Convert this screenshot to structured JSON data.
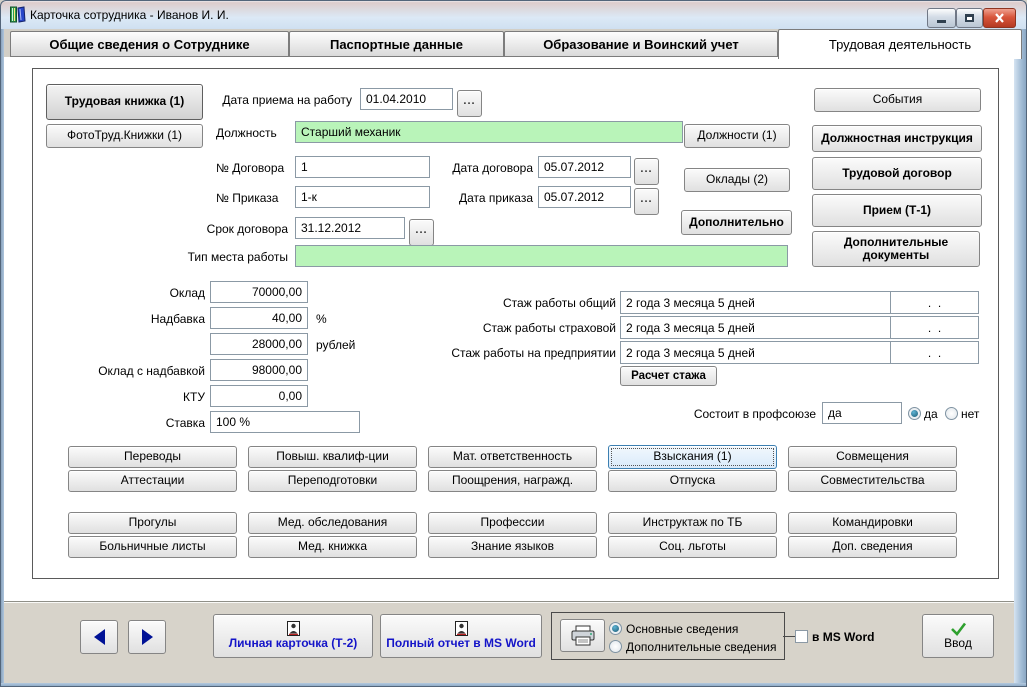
{
  "window": {
    "title": "Карточка сотрудника -  Иванов И. И."
  },
  "tabs": [
    {
      "label": "Общие сведения о Сотруднике"
    },
    {
      "label": "Паспортные данные"
    },
    {
      "label": "Образование и Воинский учет"
    },
    {
      "label": "Трудовая деятельность"
    }
  ],
  "colors": {
    "field_green": "#b9f4b9",
    "focus_blue": "#3c7fb1",
    "check_green": "#2ea02e",
    "link_blue": "#1414c8",
    "close_red": "#b53a22"
  },
  "left_panel": {
    "work_book": "Трудовая книжка (1)",
    "photo_book": "ФотоТруд.Книжки (1)"
  },
  "form": {
    "hire_date": {
      "label": "Дата приема на работу",
      "value": "01.04.2010"
    },
    "position": {
      "label": "Должность",
      "value": "Старший механик"
    },
    "contract_no": {
      "label": "№ Договора",
      "value": "1"
    },
    "contract_date": {
      "label": "Дата договора",
      "value": "05.07.2012"
    },
    "order_no": {
      "label": "№ Приказа",
      "value": "1-к"
    },
    "order_date": {
      "label": "Дата приказа",
      "value": "05.07.2012"
    },
    "contract_term": {
      "label": "Срок договора",
      "value": "31.12.2012"
    },
    "workplace_type": {
      "label": "Тип места работы",
      "value": ""
    },
    "ellipsis": "..."
  },
  "mid_buttons": {
    "positions": "Должности (1)",
    "salaries": "Оклады (2)",
    "additional": "Дополнительно"
  },
  "side_buttons": [
    "События",
    "Должностная инструкция",
    "Трудовой договор",
    "Прием (Т-1)",
    "Дополнительные документы"
  ],
  "salary": {
    "salary": {
      "label": "Оклад",
      "value": "70000,00"
    },
    "allowance": {
      "label": "Надбавка",
      "value": "40,00",
      "unit": "%"
    },
    "allowance_rub": {
      "value": "28000,00",
      "unit": "рублей"
    },
    "salary_with_allowance": {
      "label": "Оклад с надбавкой",
      "value": "98000,00"
    },
    "ktu": {
      "label": "КТУ",
      "value": "0,00"
    },
    "rate": {
      "label": "Ставка",
      "value": "100 %"
    }
  },
  "experience": {
    "total": {
      "label": "Стаж работы общий",
      "value": "2 года 3 месяца 5 дней",
      "date": ".  ."
    },
    "insurance": {
      "label": "Стаж работы страховой",
      "value": "2 года 3 месяца 5 дней",
      "date": ".  ."
    },
    "company": {
      "label": "Стаж работы на предприятии",
      "value": "2 года 3 месяца 5 дней",
      "date": ".  ."
    },
    "calc_button": "Расчет стажа"
  },
  "union": {
    "label": "Состоит в профсоюзе",
    "value": "да",
    "yes": "да",
    "no": "нет"
  },
  "action_grid": [
    [
      "Переводы",
      "Повыш. квалиф-ции",
      "Мат. ответственность",
      "Взыскания (1)",
      "Совмещения"
    ],
    [
      "Аттестации",
      "Переподготовки",
      "Поощрения, награжд.",
      "Отпуска",
      "Совместительства"
    ],
    [
      "Прогулы",
      "Мед. обследования",
      "Профессии",
      "Инструктаж по ТБ",
      "Командировки"
    ],
    [
      "Больничные листы",
      "Мед. книжка",
      "Знание языков",
      "Соц. льготы",
      "Доп. сведения"
    ]
  ],
  "bottom": {
    "personal_card": "Личная карточка (Т-2)",
    "full_report": "Полный отчет в MS Word",
    "print_main": "Основные сведения",
    "print_additional": "Дополнительные сведения",
    "word_checkbox": "в MS Word",
    "enter": "Ввод"
  }
}
